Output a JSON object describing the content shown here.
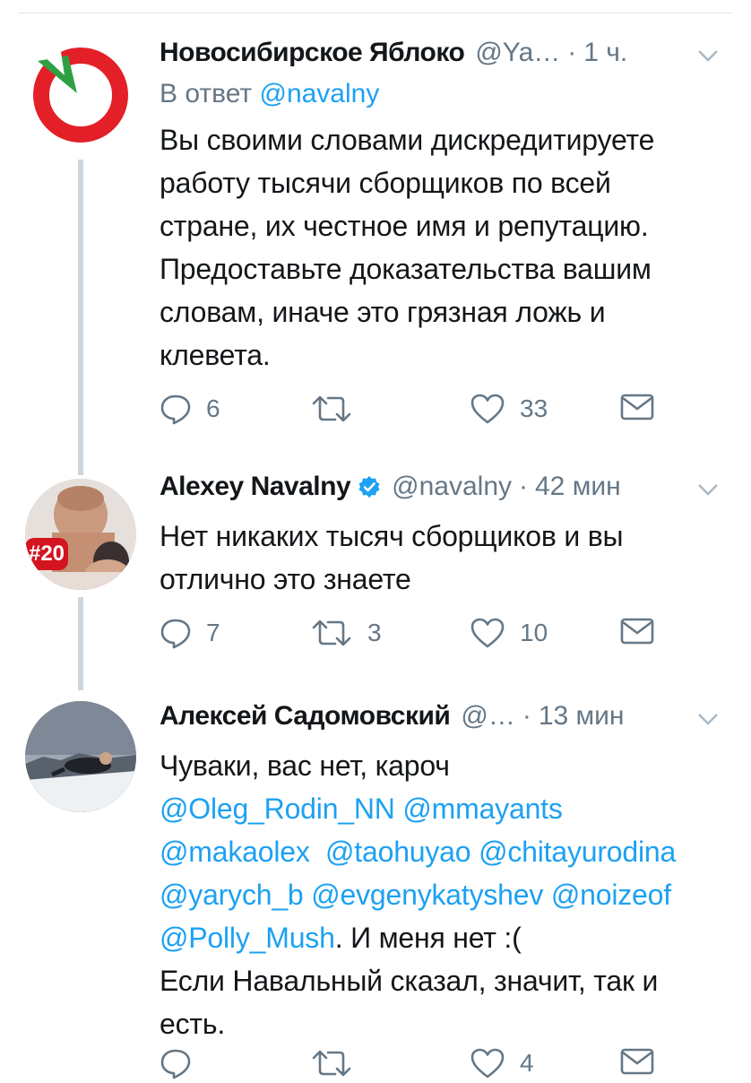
{
  "tweets": [
    {
      "name": "Новосибирское Яблоко",
      "handle": "@Ya…",
      "time": "1 ч.",
      "reply_to_label": "В ответ",
      "reply_to_handle": "@navalny",
      "lines": [
        "Вы своими словами дискредитируете",
        "работу тысячи сборщиков по всей",
        "стране, их честное имя и репутацию.",
        "Предоставьте доказательства вашим",
        "словам, иначе это грязная ложь и",
        "клевета."
      ],
      "replies": "6",
      "retweets": "",
      "likes": "33"
    },
    {
      "name": "Alexey Navalny",
      "verified": true,
      "handle": "@navalny",
      "time": "42 мин",
      "avatar_badge": "#20",
      "lines": [
        "Нет никаких тысяч сборщиков и вы",
        "отлично это знаете"
      ],
      "replies": "7",
      "retweets": "3",
      "likes": "10"
    },
    {
      "name": "Алексей Садомовский",
      "handle": "@…",
      "time": "13 мин",
      "line1": "Чуваки, вас нет, кароч",
      "mentions_1": "@Oleg_Rodin_NN @mmayants",
      "mentions_2": "@makaolex  @taohuyao @chitayurodina",
      "mentions_3": "@yarych_b @evgenykatyshev @noizeof",
      "mentions_4": "@Polly_Mush",
      "tail": ". И меня нет :(",
      "line_last_1": "Если Навальный сказал, значит, так и",
      "line_last_2": "есть.",
      "replies": "",
      "retweets": "",
      "likes": "4"
    }
  ],
  "colors": {
    "text": "#14171a",
    "secondary": "#657786",
    "link": "#1da1f2",
    "thread_line": "#ccd6dd",
    "verified": "#1da1f2",
    "yabloko_red": "#e32028",
    "yabloko_green": "#2ea043"
  }
}
